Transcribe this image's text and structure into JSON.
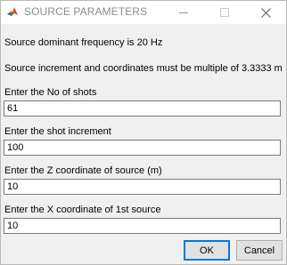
{
  "window": {
    "title": "SOURCE PARAMETERS"
  },
  "info": {
    "frequency_text": "Source dominant frequency is 20 Hz",
    "increment_text": "Source increment and coordinates must be multiple of 3.3333 m"
  },
  "fields": [
    {
      "label": "Enter the No of shots",
      "value": "61"
    },
    {
      "label": "Enter the shot increment",
      "value": "100"
    },
    {
      "label": "Enter the Z coordinate of source (m)",
      "value": "10"
    },
    {
      "label": "Enter the X coordinate of 1st source",
      "value": "10"
    }
  ],
  "buttons": {
    "ok_label": "OK",
    "cancel_label": "Cancel"
  }
}
